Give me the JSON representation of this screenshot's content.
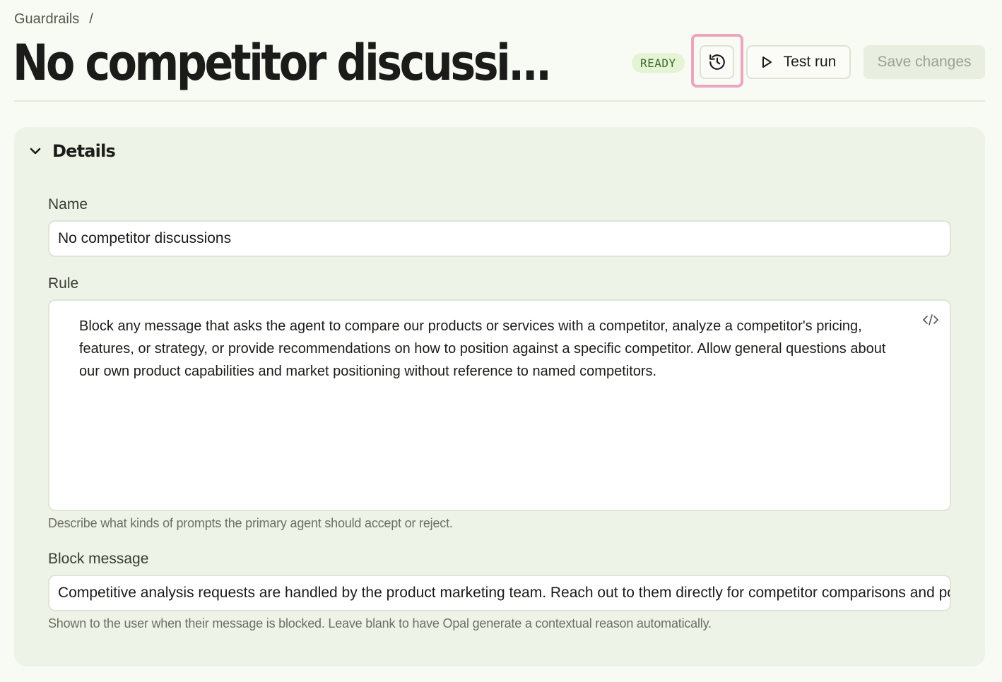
{
  "breadcrumb": {
    "parent": "Guardrails",
    "separator": "/"
  },
  "header": {
    "title": "No competitor discussi...",
    "status": "READY",
    "history_icon": "history-icon",
    "test_run_label": "Test run",
    "test_run_icon": "play-icon",
    "save_label": "Save changes"
  },
  "details": {
    "title": "Details",
    "toggle_icon": "chevron-down-icon",
    "name": {
      "label": "Name",
      "value": "No competitor discussions"
    },
    "rule": {
      "label": "Rule",
      "value": "Block any message that asks the agent to compare our products or services with a competitor, analyze a competitor's pricing, features, or strategy, or provide recommendations on how to position against a specific competitor. Allow general questions about our own product capabilities and market positioning without reference to named competitors.",
      "code_icon": "code-icon",
      "help": "Describe what kinds of prompts the primary agent should accept or reject."
    },
    "block_message": {
      "label": "Block message",
      "value": "Competitive analysis requests are handled by the product marketing team. Reach out to them directly for competitor comparisons and positi",
      "help": "Shown to the user when their message is blocked. Leave blank to have Opal generate a contextual reason automatically."
    }
  },
  "colors": {
    "background": "#f8faf4",
    "card": "#eef3e8",
    "status_bg": "#e5f4d5",
    "status_text": "#3e6a2a",
    "highlight": "#eba5c1"
  }
}
